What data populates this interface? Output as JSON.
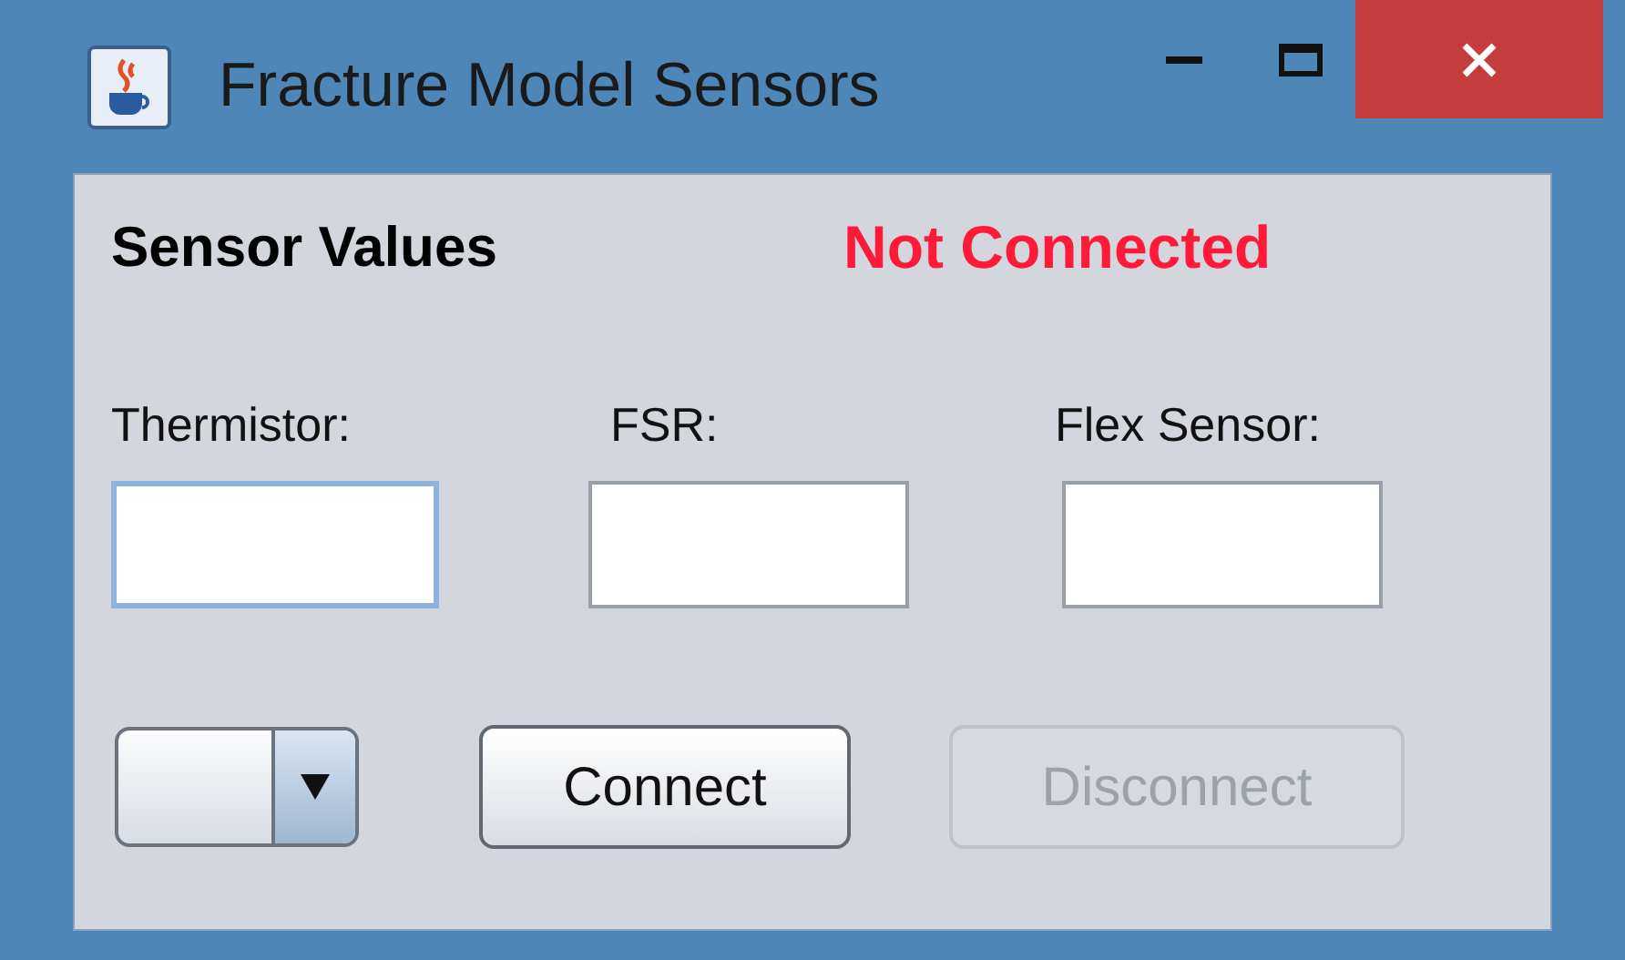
{
  "window": {
    "title": "Fracture Model Sensors"
  },
  "heading": "Sensor Values",
  "status": {
    "text": "Not Connected",
    "connected": false
  },
  "fields": [
    {
      "label": "Thermistor:",
      "focused": true
    },
    {
      "label": "FSR:",
      "focused": false
    },
    {
      "label": "Flex Sensor:",
      "focused": false
    }
  ],
  "buttons": [
    {
      "label": "Connect",
      "disabled": false
    },
    {
      "label": "Disconnect",
      "disabled": true
    }
  ]
}
